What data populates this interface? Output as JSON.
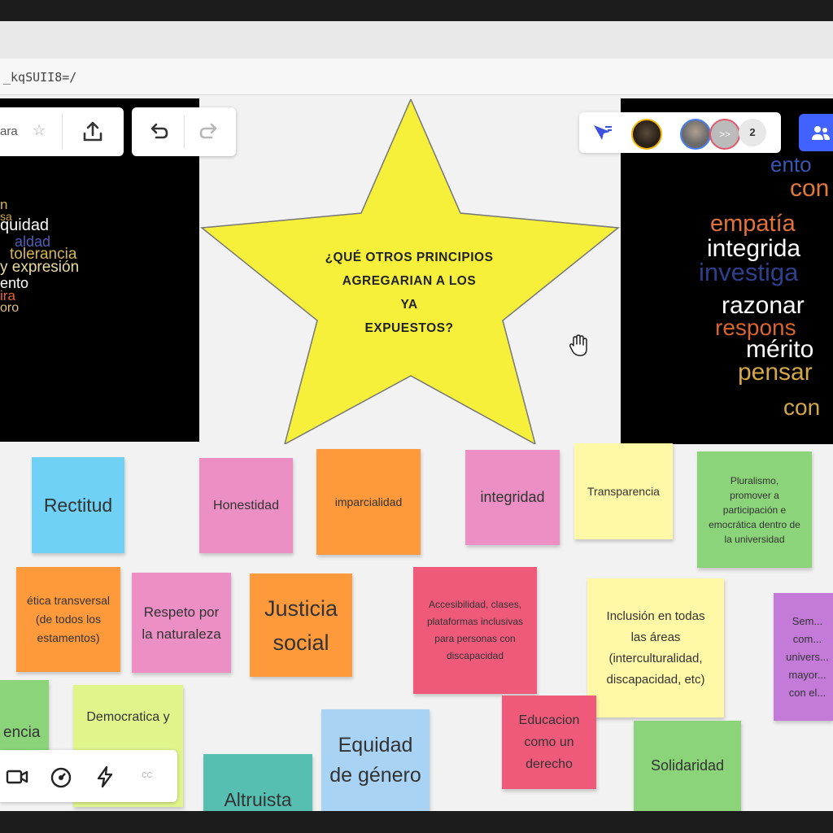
{
  "browser": {
    "url_text": "_kqSUII8=/"
  },
  "toolbar": {
    "board_name": "ara",
    "star_icon": "star-icon",
    "share_icon": "upload-icon",
    "undo_icon": "undo-icon",
    "redo_icon": "redo-icon"
  },
  "collab": {
    "cursor_icon": "cursor-arrow-icon",
    "extra_count": "2",
    "share_icon": "people-icon",
    "avatar_more": ">>"
  },
  "wordcloud_left": {
    "words": [
      "n",
      "sa",
      "quidad",
      "aldad",
      "tolerancia",
      "y expresión",
      "ento",
      "ira",
      "oro"
    ]
  },
  "wordcloud_right": {
    "words": [
      "ento",
      "con",
      "empatía",
      "integrida",
      "investiga",
      "razonar",
      "respons",
      "mérito",
      "pensar",
      "con"
    ]
  },
  "question": {
    "line1": "¿QUÉ OTROS PRINCIPIOS",
    "line2": "AGREGARIAN A LOS",
    "line3": "YA",
    "line4": "EXPUESTOS?"
  },
  "notes": {
    "rectitud": "Rectitud",
    "honestidad": "Honestidad",
    "imparcialidad": "imparcialidad",
    "integridad": "integridad",
    "transparencia": "Transparencia",
    "pluralismo": "Pluralismo, promover a participación e emocrática dentro de la universidad",
    "etica": "ética transversal (de todos los estamentos)",
    "respeto": "Respeto por la naturaleza",
    "justicia": "Justicia social",
    "accesibilidad": "Accesibilidad, clases, plataformas inclusivas para personas con discapacidad",
    "inclusion": "Inclusión en todas las áreas (interculturalidad, discapacidad, etc)",
    "sem": "Sem... com... univers... mayor... con el...",
    "encia": "encia",
    "democratica": "Democratica y",
    "equidad": "Equidad de género",
    "educacion": "Educacion como un derecho",
    "solidaridad": "Solidaridad",
    "altruista": "Altruista"
  },
  "bottom_tools": {
    "video_icon": "video-camera-icon",
    "timer_icon": "timer-icon",
    "lightning_icon": "lightning-icon",
    "cc_label": "cc"
  },
  "colors": {
    "star": "#f7f03a",
    "blue_note": "#6fd1f5",
    "pink_note": "#ec8fc4",
    "orange_note": "#ff9a3c",
    "yellow_note": "#fff8a6",
    "green_note": "#8bd47a",
    "red_note": "#ef5a7a",
    "purple_note": "#c37ad9",
    "share_button": "#4262ff"
  }
}
